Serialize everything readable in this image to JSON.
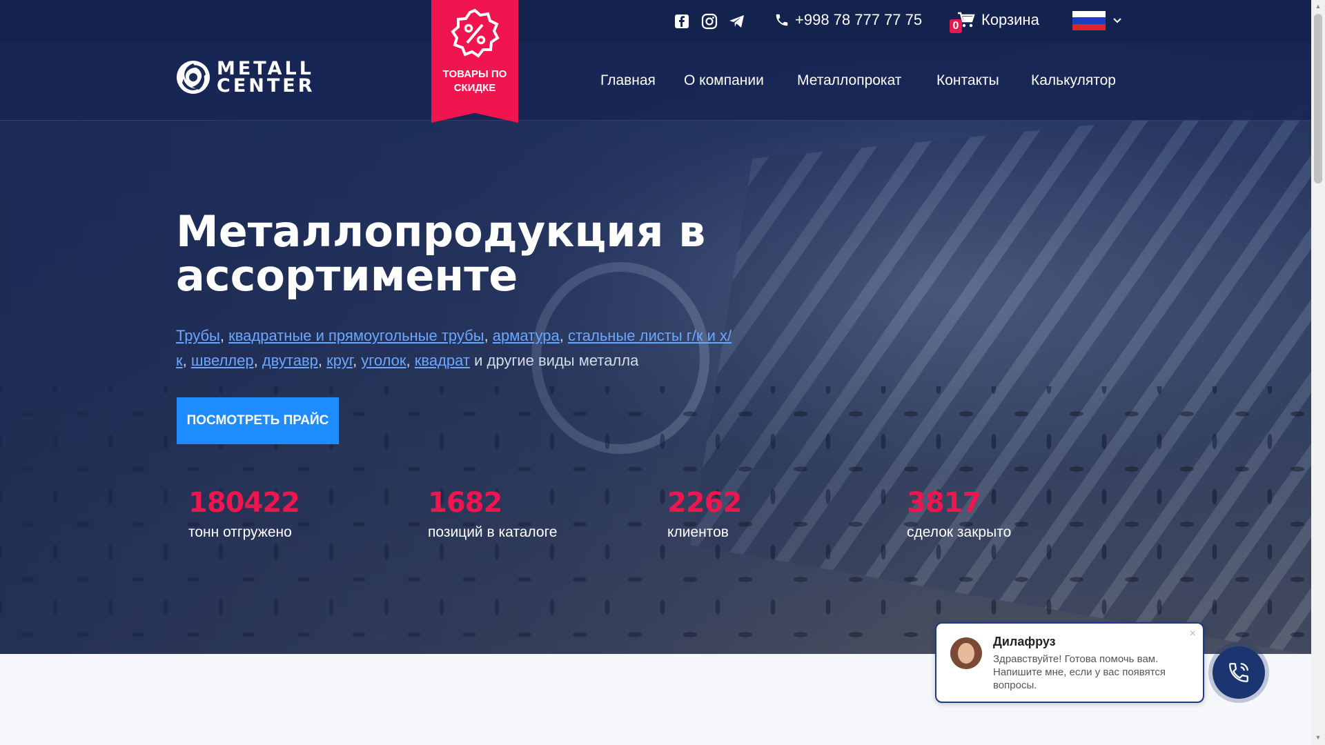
{
  "topbar": {
    "social": [
      "facebook-icon",
      "instagram-icon",
      "telegram-icon"
    ],
    "phone": "+998 78 777 77 75",
    "cart_count": "0",
    "cart_label": "Корзина",
    "language": "ru-flag-icon"
  },
  "brand": {
    "logo_line1": "METALL",
    "logo_line2": "CENTER"
  },
  "discount_badge": {
    "label": "ТОВАРЫ ПО СКИДКЕ",
    "color": "#f0154f"
  },
  "nav": {
    "items": [
      {
        "label": "Главная"
      },
      {
        "label": "О компании"
      },
      {
        "label": "Металлопрокат"
      },
      {
        "label": "Контакты"
      },
      {
        "label": "Калькулятор"
      }
    ]
  },
  "hero": {
    "title": "Металлопродукция в ассортименте",
    "links": [
      "Трубы",
      "квадратные и прямоугольные трубы",
      "арматура",
      "стальные листы г/к и х/к",
      "швеллер",
      "двутавр",
      "круг",
      "уголок",
      "квадрат"
    ],
    "tail": "и другие виды металла",
    "cta": "ПОСМОТРЕТЬ ПРАЙС"
  },
  "stats": [
    {
      "value": "180422",
      "label": "тонн отгружено"
    },
    {
      "value": "1682",
      "label": "позиций в каталоге"
    },
    {
      "value": "2262",
      "label": "клиентов"
    },
    {
      "value": "3817",
      "label": "сделок закрыто"
    }
  ],
  "chat": {
    "name": "Дилафруз",
    "message": "Здравствуйте! Готова помочь вам. Напишите мне, если у вас появятся вопросы.",
    "close": "×"
  },
  "colors": {
    "accent": "#f0154f",
    "button": "#1e8cff",
    "link": "#6aa7ff",
    "navy": "#14224e"
  }
}
